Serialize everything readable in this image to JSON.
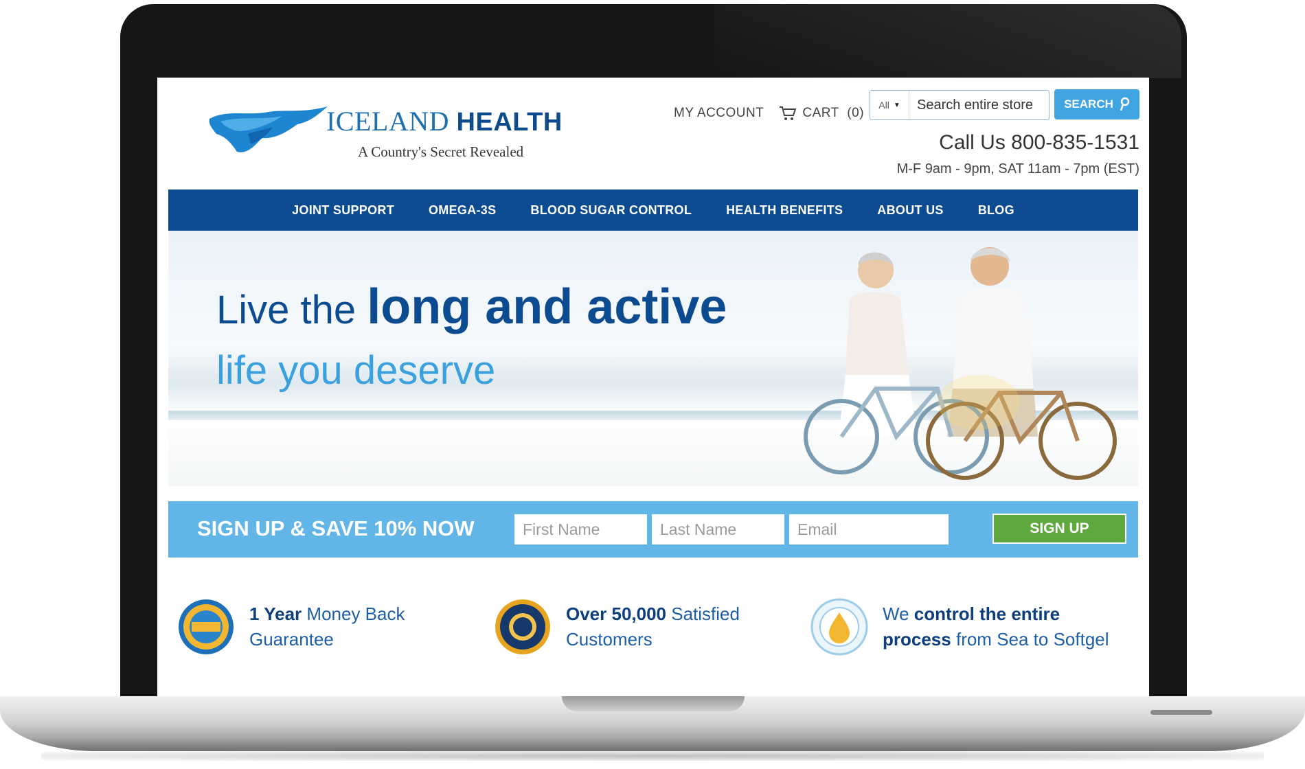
{
  "brand": {
    "name_light": "ICELAND",
    "name_bold": "HEALTH",
    "tagline": "A Country's Secret Revealed"
  },
  "header": {
    "my_account": "MY ACCOUNT",
    "cart_label": "CART",
    "cart_count": "(0)",
    "search_scope": "All",
    "search_placeholder": "Search entire store",
    "search_button": "SEARCH",
    "phone": "Call Us 800-835-1531",
    "hours": "M-F 9am - 9pm, SAT 11am - 7pm (EST)"
  },
  "nav": {
    "items": [
      {
        "label": "JOINT SUPPORT"
      },
      {
        "label": "OMEGA-3S"
      },
      {
        "label": "BLOOD SUGAR CONTROL"
      },
      {
        "label": "HEALTH BENEFITS"
      },
      {
        "label": "ABOUT US"
      },
      {
        "label": "BLOG"
      }
    ]
  },
  "hero": {
    "line1_prefix": "Live the",
    "line1_bold": "long and active",
    "line2": "life you deserve"
  },
  "signup": {
    "title": "SIGN UP & SAVE 10% NOW",
    "first_name_placeholder": "First Name",
    "last_name_placeholder": "Last Name",
    "email_placeholder": "Email",
    "button": "SIGN UP"
  },
  "features": [
    {
      "bold": "1 Year",
      "text_a": "Money Back",
      "text_b": "Guarantee",
      "badge": "money-back-guarantee-seal"
    },
    {
      "bold": "Over 50,000",
      "text_a": "Satisfied",
      "text_b": "Customers",
      "badge": "satisfaction-guaranteed-seal"
    },
    {
      "prefix": "We",
      "bold": "control the entire",
      "bold2": "process",
      "text_b": "from Sea to Softgel",
      "badge": "molecularly-distilled-seal"
    }
  ],
  "colors": {
    "nav_blue": "#0d4b91",
    "accent_blue": "#3fa4e0",
    "signup_band": "#62b6e7",
    "signup_button": "#5ea83d"
  }
}
